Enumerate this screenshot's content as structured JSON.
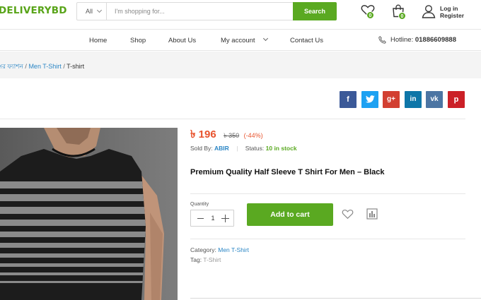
{
  "header": {
    "logo": "DELIVERYBD",
    "search": {
      "category": "All",
      "placeholder": "I'm shopping for...",
      "button": "Search"
    },
    "wishlist_count": "0",
    "cart_count": "0",
    "login_label": "Log in",
    "register_label": "Register"
  },
  "nav": {
    "items": [
      "Home",
      "Shop",
      "About Us",
      "My account",
      "Contact Us"
    ],
    "hotline_label": "Hotline:",
    "hotline_number": "01886609888"
  },
  "breadcrumb": {
    "items": [
      "সর ফ্যাশন",
      "Men T-Shirt",
      "T-shirt"
    ],
    "separator": "/"
  },
  "social": [
    "f",
    "t",
    "g+",
    "in",
    "vk",
    "p"
  ],
  "product": {
    "price": "৳ 196",
    "old_price": "৳ 350",
    "discount": "(-44%)",
    "sold_by_label": "Sold By:",
    "vendor": "ABIR",
    "status_label": "Status:",
    "status": "10 in stock",
    "title": "Premium Quality Half Sleeve T Shirt For Men – Black",
    "quantity_label": "Quantity",
    "quantity": "1",
    "add_to_cart": "Add to cart",
    "category_label": "Category:",
    "category": "Men T-Shirt",
    "tag_label": "Tag:",
    "tag": "T-Shirt"
  },
  "colors": {
    "accent": "#5aa921",
    "price": "#e8532d",
    "link": "#2b86c5"
  }
}
